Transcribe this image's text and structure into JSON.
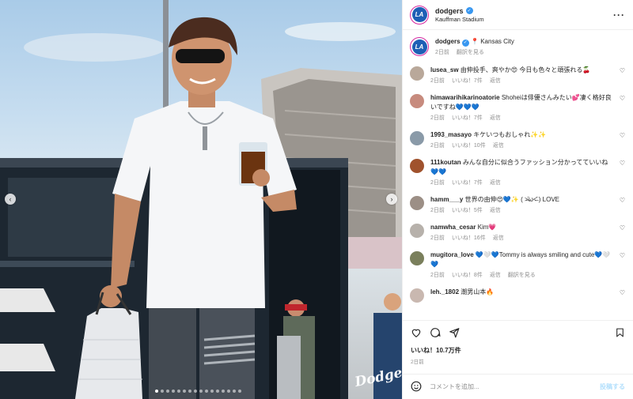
{
  "post": {
    "username": "dodgers",
    "location": "Kauffman Stadium",
    "more_icon": "more-horizontal-icon",
    "verified_icon": "verified-badge-icon",
    "avatar_text": "LA"
  },
  "caption": {
    "username": "dodgers",
    "text": "📍 Kansas City",
    "time": "2日前",
    "translate": "翻訳を見る"
  },
  "comments": [
    {
      "user": "lusea_sw",
      "text": "由伸投手、爽やか😍 今日も色々と頑張れる🍒",
      "time": "2日前",
      "likes": "いいね！7件",
      "reply": "返信",
      "avatar_color": "#b9a89a"
    },
    {
      "user": "himawarihikarinoatorie",
      "text": "Shoheiは俳優さんみたい💕凄く格好良いですね💙💙💙",
      "time": "2日前",
      "likes": "いいね！7件",
      "reply": "返信",
      "avatar_color": "#c78b7e"
    },
    {
      "user": "1993_masayo",
      "text": "キケいつもおしゃれ✨✨",
      "time": "2日前",
      "likes": "いいね！10件",
      "reply": "返信",
      "avatar_color": "#8a9aa8"
    },
    {
      "user": "111koutan",
      "text": "みんな自分に似合うファッション分かってていいね💙💙",
      "time": "2日前",
      "likes": "いいね！7件",
      "reply": "返信",
      "avatar_color": "#a0522d"
    },
    {
      "user": "hamm___y",
      "text": "世界の由伸😍💙✨ ( ˃̶᷄ω˂̶᷅ ) LOVE",
      "time": "2日前",
      "likes": "いいね！5件",
      "reply": "返信",
      "avatar_color": "#9c8f86"
    },
    {
      "user": "namwha_cesar",
      "text": "Kim💗",
      "time": "2日前",
      "likes": "いいね！16件",
      "reply": "返信",
      "avatar_color": "#b7b1ab"
    },
    {
      "user": "mugitora_love",
      "text": "💙🤍💙Tommy is always smiling and cute💙🤍💙",
      "time": "2日前",
      "likes": "いいね！8件",
      "reply": "返信",
      "extra": "翻訳を見る",
      "avatar_color": "#7a7f5c"
    },
    {
      "user": "leh._1802",
      "text": "潮男山本🔥",
      "time": "",
      "likes": "",
      "reply": "",
      "avatar_color": "#c9b8b0"
    }
  ],
  "footer": {
    "likes": "いいね！10.7万件",
    "date": "2日前",
    "comment_placeholder": "コメントを追加...",
    "post_label": "投稿する"
  },
  "photo": {
    "watermark": "Dodgers",
    "slide_count": 16,
    "active_slide": 0
  },
  "icons": {
    "heart": "heart-icon",
    "comment": "comment-icon",
    "share": "share-icon",
    "save": "bookmark-icon",
    "emoji": "emoji-icon",
    "prev": "chevron-left-icon",
    "next": "chevron-right-icon"
  }
}
